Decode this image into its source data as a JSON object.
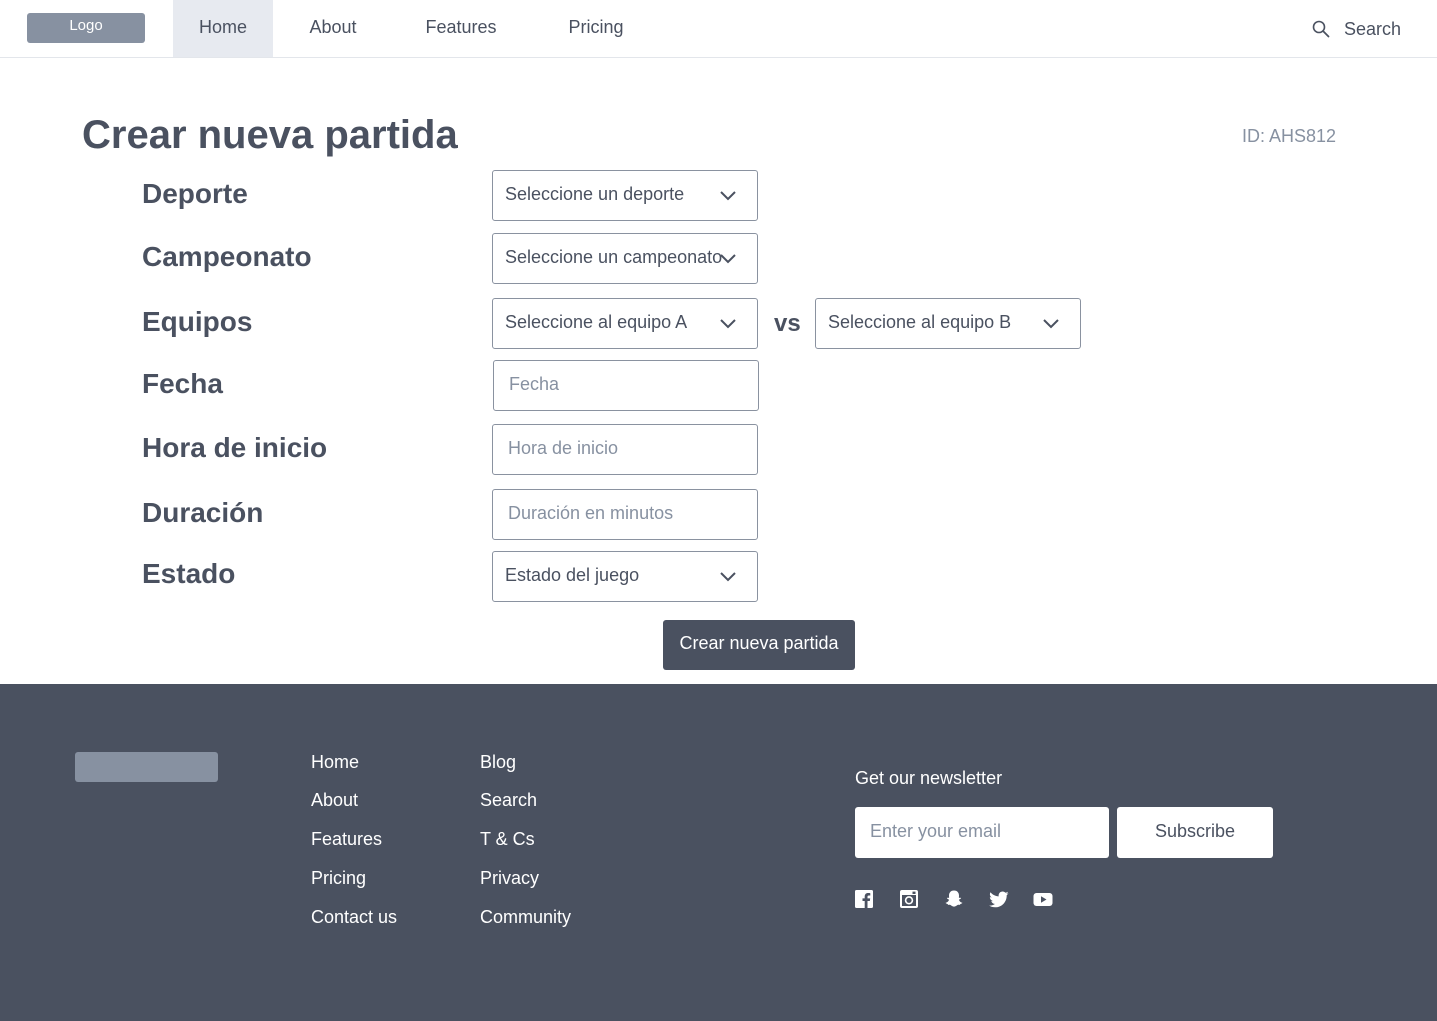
{
  "nav": {
    "logo": "Logo",
    "items": [
      "Home",
      "About",
      "Features",
      "Pricing"
    ],
    "active": "Home",
    "search_label": "Search"
  },
  "form": {
    "title": "Crear nueva partida",
    "id_label": "ID: AHS812",
    "fields": {
      "deporte": {
        "label": "Deporte",
        "value": "Seleccione un deporte"
      },
      "campeonato": {
        "label": "Campeonato",
        "value": "Seleccione un campeonato"
      },
      "equipos": {
        "label": "Equipos",
        "team_a": "Seleccione al equipo A",
        "vs": "vs",
        "team_b": "Seleccione al equipo B"
      },
      "fecha": {
        "label": "Fecha",
        "placeholder": "Fecha"
      },
      "hora": {
        "label": "Hora de inicio",
        "placeholder": "Hora de inicio"
      },
      "duracion": {
        "label": "Duración",
        "placeholder": "Duración en minutos"
      },
      "estado": {
        "label": "Estado",
        "value": "Estado del juego"
      }
    },
    "submit_label": "Crear nueva partida"
  },
  "footer": {
    "col1": [
      "Home",
      "About",
      "Features",
      "Pricing",
      "Contact us"
    ],
    "col2": [
      "Blog",
      "Search",
      "T & Cs",
      "Privacy",
      "Community"
    ],
    "newsletter": {
      "title": "Get our newsletter",
      "email_placeholder": "Enter your email",
      "subscribe_label": "Subscribe"
    },
    "social_icons": [
      "facebook-icon",
      "instagram-icon",
      "snapchat-icon",
      "twitter-icon",
      "youtube-icon"
    ]
  },
  "colors": {
    "primary": "#4a5160",
    "muted": "#8791a1",
    "nav_active_bg": "#e7eaf0",
    "white": "#ffffff"
  }
}
